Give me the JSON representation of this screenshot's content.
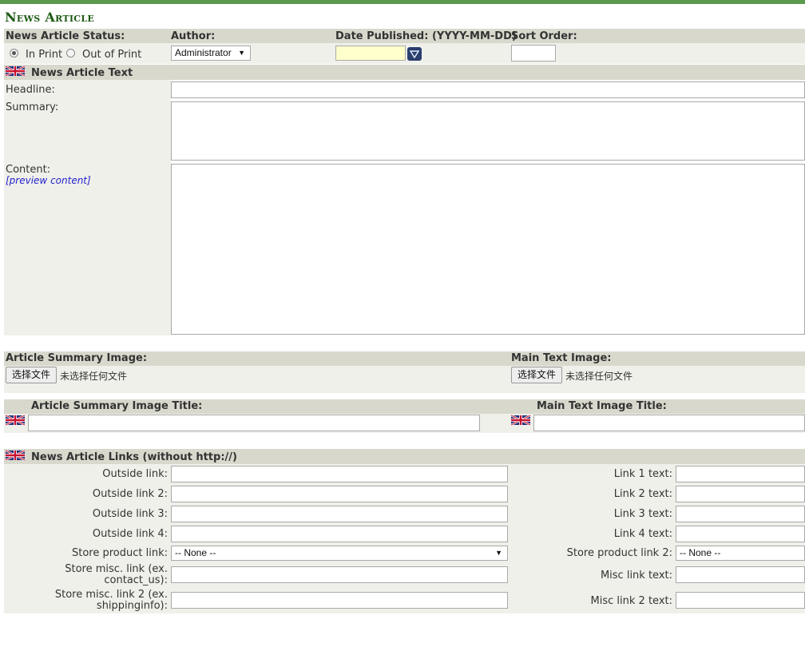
{
  "page_title": "News Article",
  "status": {
    "label": "News Article Status:",
    "options": [
      {
        "label": "In Print",
        "selected": true
      },
      {
        "label": "Out of Print",
        "selected": false
      }
    ]
  },
  "author": {
    "label": "Author:",
    "value": "Administrator"
  },
  "date_published": {
    "label": "Date Published: (YYYY-MM-DD)",
    "value": ""
  },
  "sort_order": {
    "label": "Sort Order:",
    "value": ""
  },
  "article_text": {
    "section_label": "News Article Text",
    "headline_label": "Headline:",
    "summary_label": "Summary:",
    "content_label": "Content:",
    "preview_link": "[preview content]"
  },
  "images": {
    "summary_image_label": "Article Summary Image:",
    "main_image_label": "Main Text Image:",
    "choose_file_button": "选择文件",
    "no_file_text": "未选择任何文件",
    "summary_image_title_label": "Article Summary Image Title:",
    "main_image_title_label": "Main Text Image Title:"
  },
  "links": {
    "section_label": "News Article Links (without http://)",
    "left": [
      {
        "label": "Outside link:",
        "value": ""
      },
      {
        "label": "Outside link 2:",
        "value": ""
      },
      {
        "label": "Outside link 3:",
        "value": ""
      },
      {
        "label": "Outside link 4:",
        "value": ""
      },
      {
        "label": "Store product link:",
        "value": "-- None --"
      },
      {
        "label": "Store misc. link (ex. contact_us):",
        "value": ""
      },
      {
        "label": "Store misc. link 2 (ex. shippinginfo):",
        "value": ""
      }
    ],
    "right": [
      {
        "label": "Link 1 text:",
        "value": ""
      },
      {
        "label": "Link 2 text:",
        "value": ""
      },
      {
        "label": "Link 3 text:",
        "value": ""
      },
      {
        "label": "Link 4 text:",
        "value": ""
      },
      {
        "label": "Store product link 2:",
        "value": "-- None --"
      },
      {
        "label": "Misc link text:",
        "value": ""
      },
      {
        "label": "Misc link 2 text:",
        "value": ""
      }
    ]
  },
  "icons": {
    "flag": "uk-flag-icon",
    "calendar": "calendar-dropdown-icon"
  },
  "colors": {
    "accent": "#5a9a4f",
    "title": "#1c5a12",
    "header_bg": "#d8d8cd",
    "panel_bg": "#f0f0eb",
    "date_bg": "#ffffcc",
    "link": "#2222cc"
  }
}
